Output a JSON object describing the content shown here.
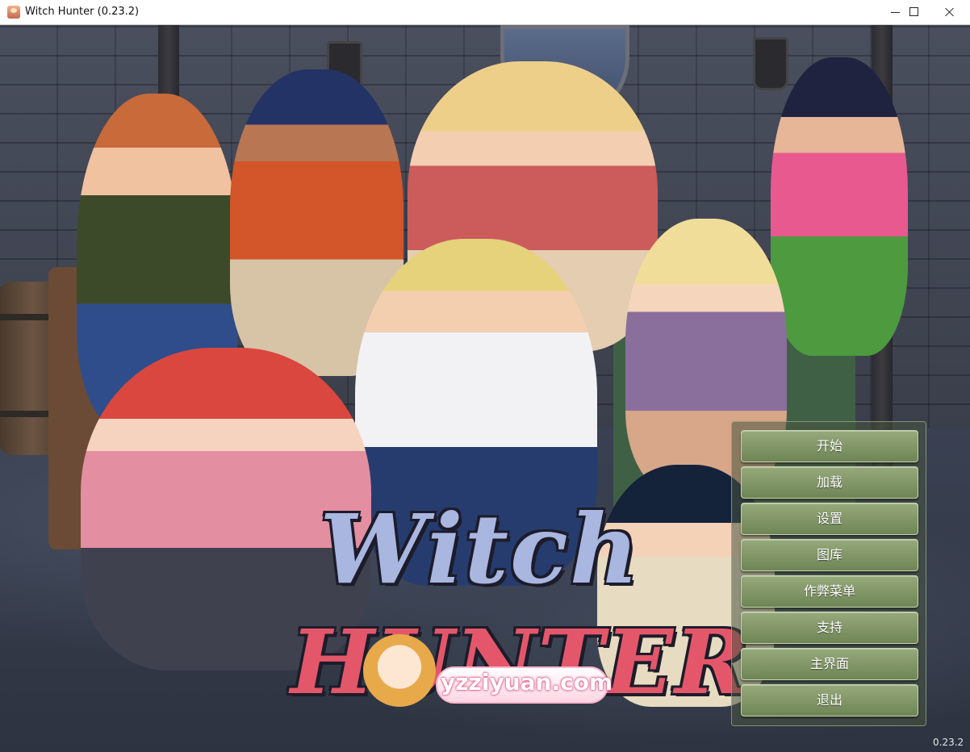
{
  "window": {
    "title": "Witch Hunter (0.23.2)"
  },
  "logo": {
    "line1": "Witch",
    "line2": "HUNTER"
  },
  "watermark": {
    "text": "yzziyuan.com"
  },
  "menu": {
    "items": [
      {
        "label": "开始"
      },
      {
        "label": "加载"
      },
      {
        "label": "设置"
      },
      {
        "label": "图库"
      },
      {
        "label": "作弊菜单"
      },
      {
        "label": "支持"
      },
      {
        "label": "主界面"
      },
      {
        "label": "退出"
      }
    ]
  },
  "version": "0.23.2",
  "icons": {
    "app": "witch-hunter-app-icon",
    "minimize": "minimize-icon",
    "maximize": "maximize-icon",
    "close": "close-icon"
  },
  "colors": {
    "menu_button": "#7f956a",
    "menu_text": "#ffffff",
    "logo_top": "#a8b6e0",
    "logo_bottom": "#e4576a"
  }
}
